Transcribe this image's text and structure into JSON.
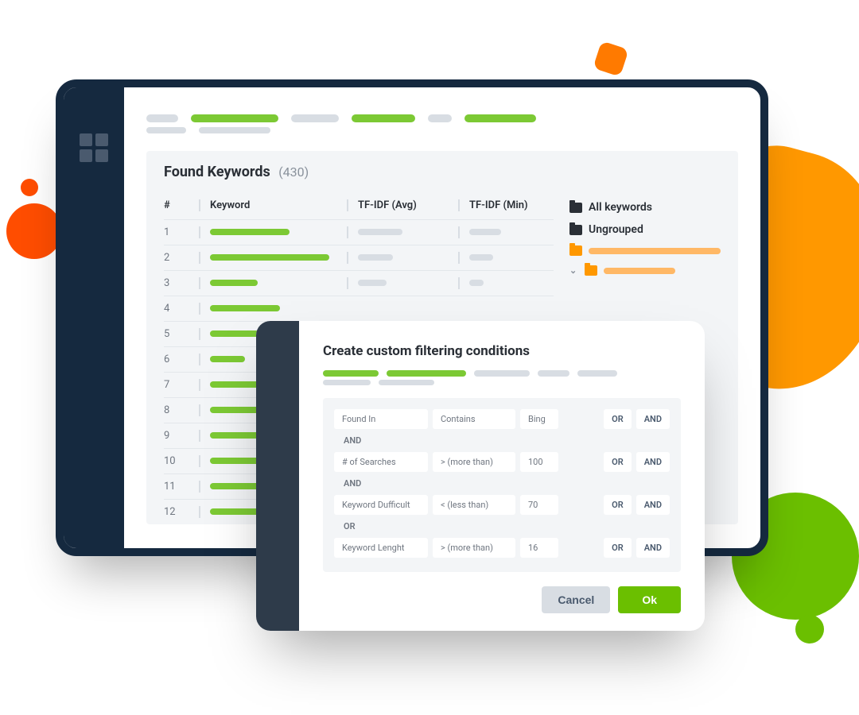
{
  "panel": {
    "title": "Found Keywords",
    "count": "(430)"
  },
  "table": {
    "headers": {
      "num": "#",
      "keyword": "Keyword",
      "avg": "TF-IDF (Avg)",
      "min": "TF-IDF (Min)"
    },
    "rows": [
      {
        "n": "1",
        "kw": 100,
        "avg": 56,
        "min": 40
      },
      {
        "n": "2",
        "kw": 150,
        "avg": 44,
        "min": 30
      },
      {
        "n": "3",
        "kw": 60,
        "avg": 36,
        "min": 18
      },
      {
        "n": "4",
        "kw": 88,
        "avg": 0,
        "min": 0
      },
      {
        "n": "5",
        "kw": 72,
        "avg": 0,
        "min": 0
      },
      {
        "n": "6",
        "kw": 44,
        "avg": 0,
        "min": 0
      },
      {
        "n": "7",
        "kw": 96,
        "avg": 0,
        "min": 0
      },
      {
        "n": "8",
        "kw": 110,
        "avg": 0,
        "min": 0
      },
      {
        "n": "9",
        "kw": 80,
        "avg": 0,
        "min": 0
      },
      {
        "n": "10",
        "kw": 90,
        "avg": 0,
        "min": 0
      },
      {
        "n": "11",
        "kw": 100,
        "avg": 0,
        "min": 0
      },
      {
        "n": "12",
        "kw": 70,
        "avg": 0,
        "min": 0
      }
    ]
  },
  "sidebar": {
    "all": "All keywords",
    "ungrouped": "Ungrouped"
  },
  "modal": {
    "title": "Create custom filtering conditions",
    "conditions": [
      {
        "field": "Found In",
        "op": "Contains",
        "val": "Bing",
        "or": "OR",
        "and": "AND",
        "joinAfter": "AND"
      },
      {
        "field": "# of Searches",
        "op": "> (more than)",
        "val": "100",
        "or": "OR",
        "and": "AND",
        "joinAfter": "AND"
      },
      {
        "field": "Keyword Dufficult",
        "op": "< (less than)",
        "val": "70",
        "or": "OR",
        "and": "AND",
        "joinAfter": "OR"
      },
      {
        "field": "Keyword Lenght",
        "op": "> (more than)",
        "val": "16",
        "or": "OR",
        "and": "AND",
        "joinAfter": ""
      }
    ],
    "cancel": "Cancel",
    "ok": "Ok"
  }
}
